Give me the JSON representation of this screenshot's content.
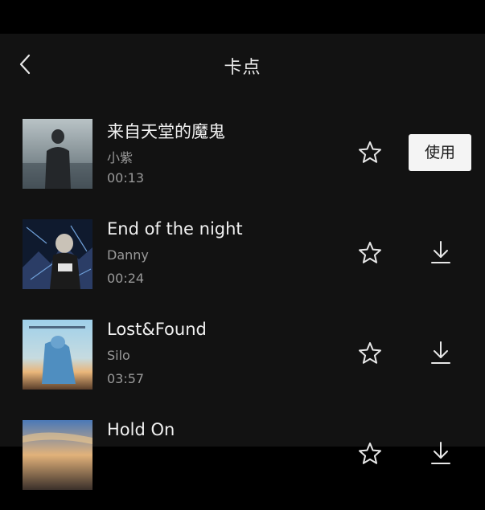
{
  "header": {
    "title": "卡点",
    "back_icon": "chevron-left-icon"
  },
  "songs": [
    {
      "title": "来自天堂的魔鬼",
      "artist": "小紫",
      "duration": "00:13",
      "action": "use",
      "action_label": "使用"
    },
    {
      "title": "End of the night",
      "artist": "Danny",
      "duration": "00:24",
      "action": "download"
    },
    {
      "title": "Lost&Found",
      "artist": "Silo",
      "duration": "03:57",
      "action": "download"
    },
    {
      "title": "Hold On",
      "artist": "",
      "duration": "",
      "action": "download"
    }
  ],
  "icons": {
    "favorite": "star-icon",
    "download": "download-icon"
  },
  "colors": {
    "background": "#121212",
    "status_bar": "#000000",
    "text_primary": "#f0f0f0",
    "text_secondary": "#9a9a9a",
    "use_button_bg": "#f4f4f4"
  }
}
